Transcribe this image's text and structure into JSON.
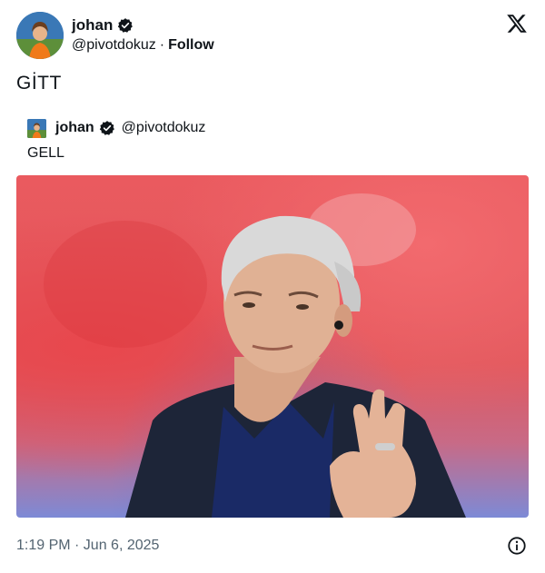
{
  "author": {
    "display_name": "johan",
    "handle": "@pivotdokuz",
    "separator": "·",
    "follow_label": "Follow",
    "verified": true
  },
  "tweet": {
    "text": "GİTT",
    "timestamp": "1:19 PM · Jun 6, 2025"
  },
  "quoted_tweet": {
    "display_name": "johan",
    "handle": "@pivotdokuz",
    "text": "GELL",
    "verified": true
  },
  "media": {
    "subject": "photo-man-waving"
  },
  "icons": {
    "brand": "x-logo-icon",
    "verified": "verified-badge-icon",
    "info": "info-icon"
  },
  "colors": {
    "text": "#0f1419",
    "secondary": "#536471",
    "background": "#ffffff"
  }
}
